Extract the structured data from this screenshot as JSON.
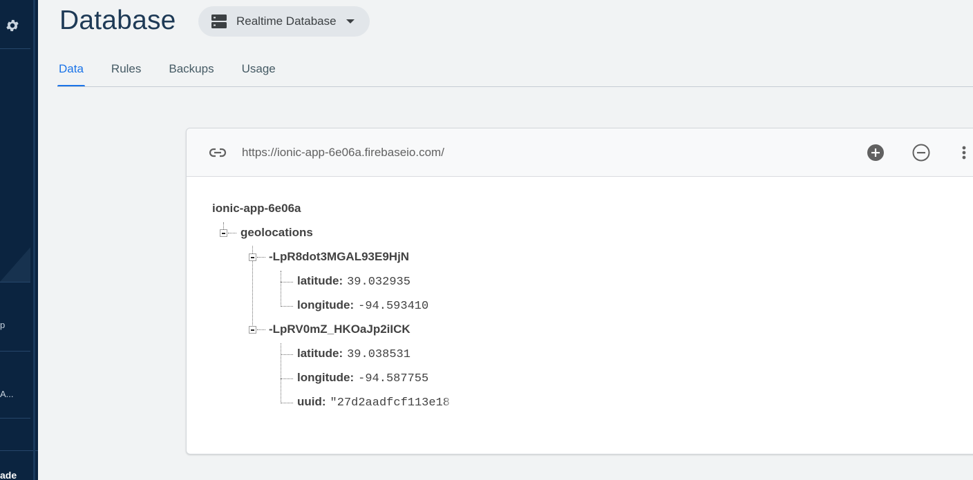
{
  "sidebar": {
    "item_a": "p",
    "item_b": "A...",
    "upgrade_label": "ade"
  },
  "header": {
    "title": "Database",
    "db_select_label": "Realtime Database"
  },
  "tabs": [
    {
      "label": "Data",
      "active": true
    },
    {
      "label": "Rules",
      "active": false
    },
    {
      "label": "Backups",
      "active": false
    },
    {
      "label": "Usage",
      "active": false
    }
  ],
  "database": {
    "url": "https://ionic-app-6e06a.firebaseio.com/",
    "root": "ionic-app-6e06a",
    "child": "geolocations",
    "entries": [
      {
        "key": "-LpR8dot3MGAL93E9HjN",
        "fields": [
          {
            "key": "latitude:",
            "value": "39.032935"
          },
          {
            "key": "longitude:",
            "value": "-94.593410"
          }
        ]
      },
      {
        "key": "-LpRV0mZ_HKOaJp2iICK",
        "fields": [
          {
            "key": "latitude:",
            "value": "39.038531"
          },
          {
            "key": "longitude:",
            "value": "-94.587755"
          },
          {
            "key": "uuid:",
            "value": "\"27d2aadfcf113e18"
          }
        ]
      }
    ]
  },
  "colors": {
    "accent": "#1a73e8",
    "sidebar_bg": "#0b2440",
    "title": "#1e3a56"
  }
}
